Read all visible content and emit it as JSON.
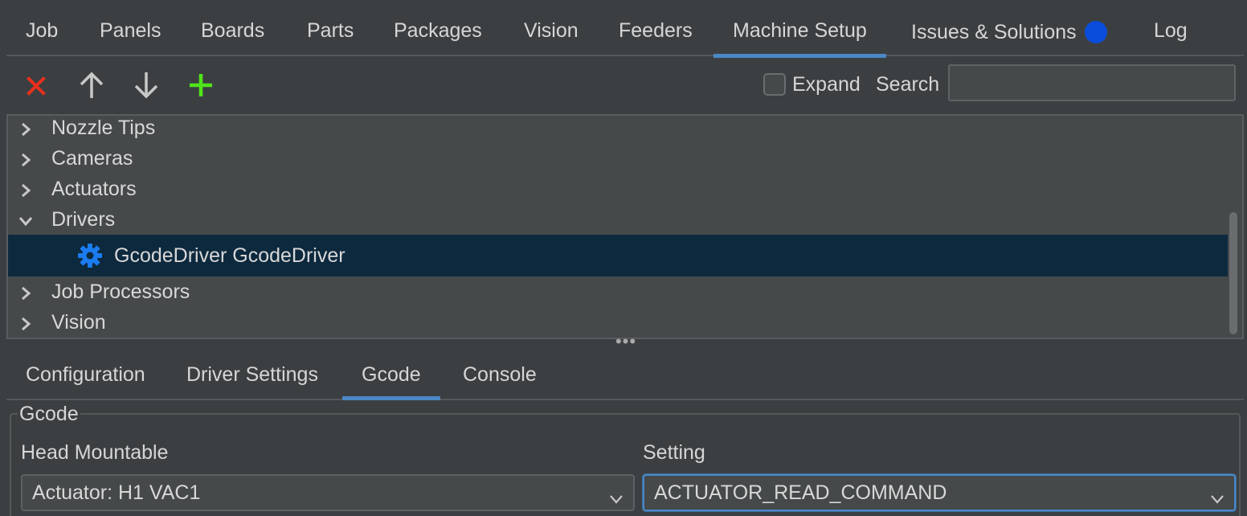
{
  "top_tabs": [
    {
      "label": "Job"
    },
    {
      "label": "Panels"
    },
    {
      "label": "Boards"
    },
    {
      "label": "Parts"
    },
    {
      "label": "Packages"
    },
    {
      "label": "Vision"
    },
    {
      "label": "Feeders"
    },
    {
      "label": "Machine Setup"
    },
    {
      "label": "Issues & Solutions"
    },
    {
      "label": "Log"
    }
  ],
  "active_top_tab": "Machine Setup",
  "toolbar": {
    "expand_label": "Expand",
    "expand_checked": false,
    "search_label": "Search",
    "search_value": ""
  },
  "icons": {
    "delete": "close-icon",
    "move_up": "arrow-up-icon",
    "move_down": "arrow-down-icon",
    "add": "plus-icon",
    "driver": "gear-icon"
  },
  "colors": {
    "delete": "#e8301c",
    "add": "#4ee51a",
    "accent": "#4a88c7",
    "badge": "#0a4ddb",
    "selection": "#0d293e",
    "gear": "#1b7bf0"
  },
  "tree": {
    "items": [
      {
        "label": "Nozzle Tips",
        "expanded": false
      },
      {
        "label": "Cameras",
        "expanded": false
      },
      {
        "label": "Actuators",
        "expanded": false
      },
      {
        "label": "Drivers",
        "expanded": true
      },
      {
        "label": "GcodeDriver GcodeDriver",
        "child": true,
        "selected": true
      },
      {
        "label": "Job Processors",
        "expanded": false
      },
      {
        "label": "Vision",
        "expanded": false
      }
    ]
  },
  "sub_tabs": [
    {
      "label": "Configuration"
    },
    {
      "label": "Driver Settings"
    },
    {
      "label": "Gcode"
    },
    {
      "label": "Console"
    }
  ],
  "active_sub_tab": "Gcode",
  "gcode": {
    "group_title": "Gcode",
    "head_mountable_label": "Head Mountable",
    "head_mountable_value": "Actuator: H1 VAC1",
    "setting_label": "Setting",
    "setting_value": "ACTUATOR_READ_COMMAND"
  }
}
